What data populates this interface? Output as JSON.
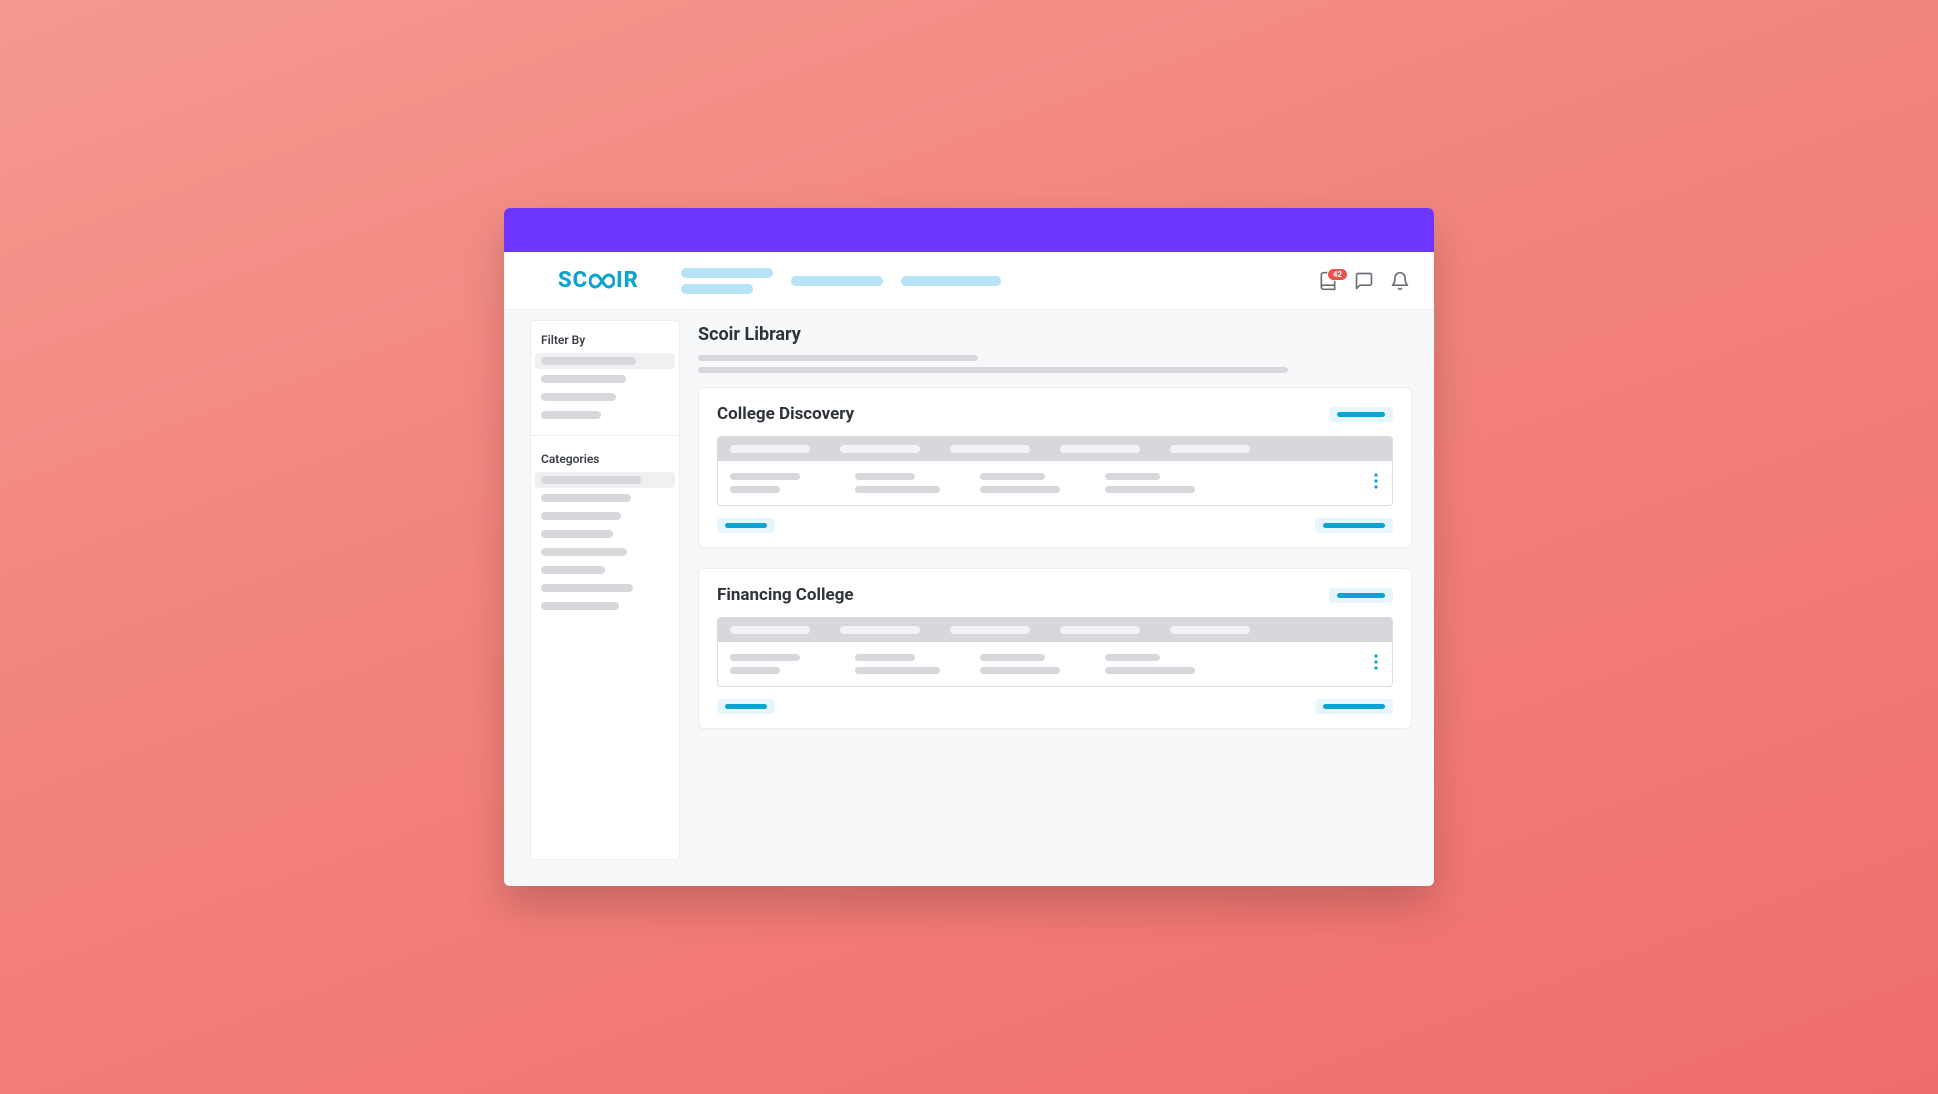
{
  "brand": {
    "name": "SCOIR"
  },
  "header": {
    "nav_placeholders": 3,
    "icons": {
      "library": "library-icon",
      "chat": "chat-icon",
      "bell": "bell-icon"
    },
    "badge_count": "42"
  },
  "sidebar": {
    "filter_title": "Filter By",
    "filter_items_count": 4,
    "categories_title": "Categories",
    "category_items_count": 8
  },
  "page": {
    "title": "Scoir Library",
    "description_lines": 2
  },
  "cards": [
    {
      "title": "College Discovery",
      "columns": 5,
      "row_cells": 4
    },
    {
      "title": "Financing College",
      "columns": 5,
      "row_cells": 4
    }
  ],
  "colors": {
    "accent_purple": "#6e35ff",
    "brand_teal": "#0ba3d1",
    "background_coral_start": "#f4988e",
    "background_coral_end": "#ef6e6b"
  }
}
